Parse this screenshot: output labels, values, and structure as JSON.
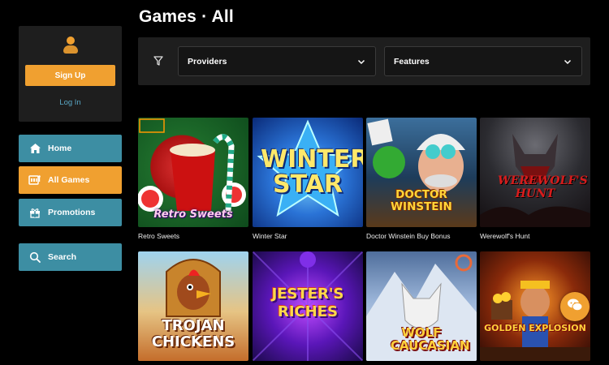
{
  "page": {
    "title": "Games · All"
  },
  "auth": {
    "signup_label": "Sign Up",
    "login_label": "Log In"
  },
  "nav": {
    "items": [
      {
        "label": "Home",
        "icon": "home-icon"
      },
      {
        "label": "All Games",
        "icon": "slot-machine-icon"
      },
      {
        "label": "Promotions",
        "icon": "gift-icon"
      },
      {
        "label": "Search",
        "icon": "search-icon"
      }
    ]
  },
  "filters": {
    "providers_label": "Providers",
    "features_label": "Features"
  },
  "games": [
    {
      "title": "Retro Sweets",
      "art": "Retro Sweets"
    },
    {
      "title": "Winter Star",
      "art": "WINTER STAR"
    },
    {
      "title": "Doctor Winstein Buy Bonus",
      "art": "DOCTOR WINSTEIN"
    },
    {
      "title": "Werewolf's Hunt",
      "art": "WEREWOLF'S HUNT"
    },
    {
      "title": "",
      "art": "TROJAN CHICKENS"
    },
    {
      "title": "",
      "art": "JESTER'S RICHES"
    },
    {
      "title": "",
      "art": "WOLF CAUCASIAN"
    },
    {
      "title": "",
      "art": "GOLDEN EXPLOSION"
    }
  ],
  "colors": {
    "accent": "#f0a030",
    "teal": "#3d8ea3",
    "panel": "#1e1e1e",
    "background": "#000000"
  }
}
